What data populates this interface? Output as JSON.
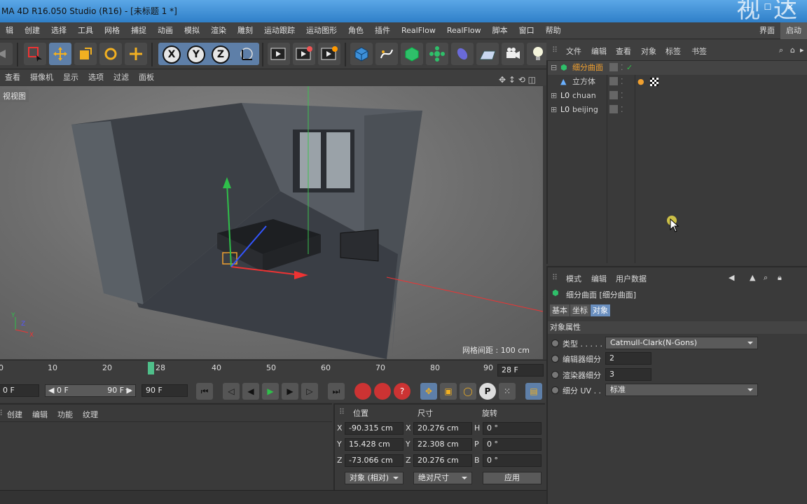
{
  "title": "MA 4D R16.050 Studio (R16) - [未标题 1 *]",
  "watermark": "视 达",
  "window_buttons": [
    "—",
    "☐",
    "✕"
  ],
  "menu": [
    "辑",
    "创建",
    "选择",
    "工具",
    "网格",
    "捕捉",
    "动画",
    "模拟",
    "渲染",
    "雕刻",
    "运动跟踪",
    "运动图形",
    "角色",
    "插件",
    "RealFlow",
    "RealFlow",
    "脚本",
    "窗口",
    "帮助"
  ],
  "menu_right": [
    "界面",
    "启动"
  ],
  "viewport_menu": [
    "查看",
    "摄像机",
    "显示",
    "选项",
    "过滤",
    "面板"
  ],
  "viewport_icons": "✥ ↕ ⟲ ◫",
  "viewport_label": "视视图",
  "grid_label": "网格间距 : 100 cm",
  "axis_labels": {
    "x": "X",
    "y": "Y",
    "z": "Z"
  },
  "object_manager": {
    "menu": [
      "文件",
      "编辑",
      "查看",
      "对象",
      "标签",
      "书签"
    ],
    "objects": [
      {
        "name": "细分曲面",
        "prefix": "⊟",
        "selected": true,
        "check": "✓"
      },
      {
        "name": "立方体",
        "prefix": "",
        "selected": false,
        "check": ""
      },
      {
        "name": "chuan",
        "prefix": "⊞",
        "selected": false,
        "check": ""
      },
      {
        "name": "beijing",
        "prefix": "⊞",
        "selected": false,
        "check": ""
      }
    ]
  },
  "attributes": {
    "menu": [
      "模式",
      "编辑",
      "用户数据"
    ],
    "header": "细分曲面 [细分曲面]",
    "tabs": [
      "基本",
      "坐标",
      "对象"
    ],
    "active_tab": "对象",
    "section": "对象属性",
    "type_label": "类型 . . . . .",
    "type_value": "Catmull-Clark(N-Gons)",
    "editor_label": "编辑器细分",
    "editor_value": "2",
    "render_label": "渲染器细分",
    "render_value": "3",
    "uv_label": "细分 UV . .",
    "uv_value": "标准"
  },
  "timeline": {
    "ticks": [
      "0",
      "10",
      "20",
      "28",
      "40",
      "50",
      "60",
      "70",
      "80",
      "90"
    ],
    "current_frame": 28,
    "frame_field": "28 F",
    "start_field": "0 F",
    "range_start": "◀ 0 F",
    "range_end": "90 F ▶",
    "end_field": "90 F"
  },
  "material_menu": [
    "创建",
    "编辑",
    "功能",
    "纹理"
  ],
  "coordinates": {
    "headers": [
      "位置",
      "尺寸",
      "旋转"
    ],
    "rows": [
      {
        "axis": "X",
        "pos": "-90.315 cm",
        "size_axis": "X",
        "size": "20.276 cm",
        "rot_axis": "H",
        "rot": "0 °"
      },
      {
        "axis": "Y",
        "pos": "15.428 cm",
        "size_axis": "Y",
        "size": "22.308 cm",
        "rot_axis": "P",
        "rot": "0 °"
      },
      {
        "axis": "Z",
        "pos": "-73.066 cm",
        "size_axis": "Z",
        "size": "20.276 cm",
        "rot_axis": "B",
        "rot": "0 °"
      }
    ],
    "mode_dropdown": "对象 (相对)",
    "size_dropdown": "绝对尺寸",
    "apply": "应用"
  },
  "colors": {
    "accent": "#6a8fbf",
    "selected": "#f0a030",
    "playhead": "#4fbf8a"
  }
}
